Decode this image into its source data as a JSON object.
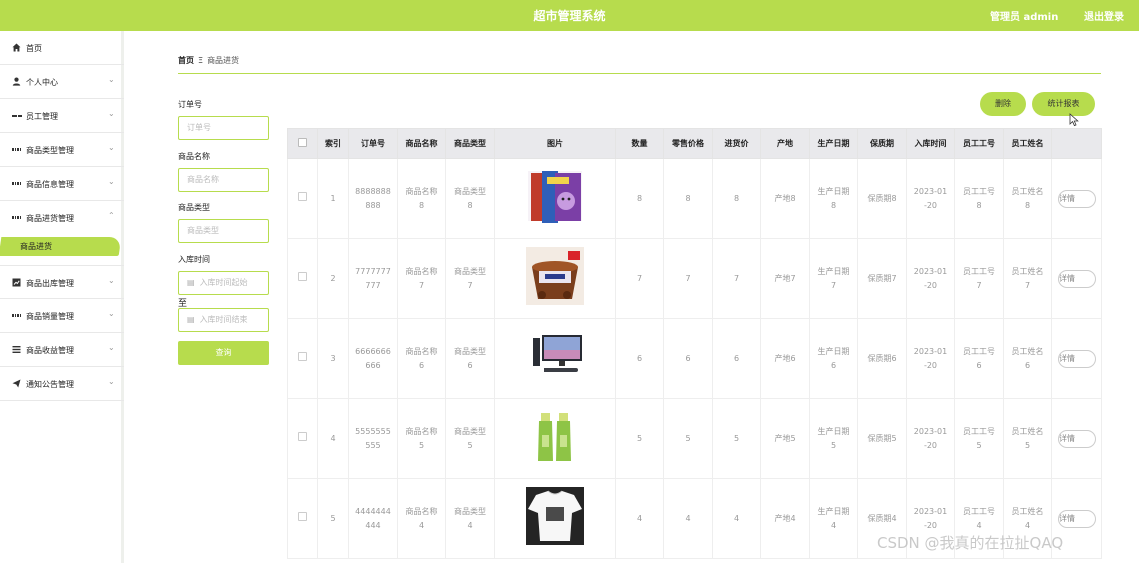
{
  "header": {
    "title": "超市管理系统",
    "user": "管理员 admin",
    "logout": "退出登录"
  },
  "sidebar": {
    "items": [
      {
        "label": "首页",
        "icon": "home-icon"
      },
      {
        "label": "个人中心",
        "icon": "user-icon"
      },
      {
        "label": "员工管理",
        "icon": "grid-icon"
      },
      {
        "label": "商品类型管理",
        "icon": "apps-icon"
      },
      {
        "label": "商品信息管理",
        "icon": "apps-icon"
      },
      {
        "label": "商品进货管理",
        "icon": "apps-icon"
      },
      {
        "label": "商品出库管理",
        "icon": "chart-icon"
      },
      {
        "label": "商品销量管理",
        "icon": "apps-icon"
      },
      {
        "label": "商品收益管理",
        "icon": "list-icon"
      },
      {
        "label": "通知公告管理",
        "icon": "send-icon"
      }
    ],
    "sub_item": "商品进货"
  },
  "breadcrumb": {
    "home": "首页",
    "sep": "Ξ",
    "current": "商品进货"
  },
  "filters": {
    "order_label": "订单号",
    "order_placeholder": "订单号",
    "name_label": "商品名称",
    "name_placeholder": "商品名称",
    "type_label": "商品类型",
    "type_placeholder": "商品类型",
    "time_label": "入库时间",
    "time_start_placeholder": "入库时间起始",
    "to_label": "至",
    "time_end_placeholder": "入库时间结束",
    "search": "查询"
  },
  "actions": {
    "delete": "删除",
    "stats": "统计报表"
  },
  "table": {
    "columns": [
      "索引",
      "订单号",
      "商品名称",
      "商品类型",
      "图片",
      "数量",
      "零售价格",
      "进货价",
      "产地",
      "生产日期",
      "保质期",
      "入库时间",
      "员工工号",
      "员工姓名"
    ],
    "detail_label": "详情",
    "rows": [
      {
        "index": "1",
        "order": [
          "8888888",
          "888"
        ],
        "name": [
          "商品名称",
          "8"
        ],
        "type": [
          "商品类型",
          "8"
        ],
        "qty": "8",
        "retail": "8",
        "cost": "8",
        "origin": "产地8",
        "prod": [
          "生产日期",
          "8"
        ],
        "shelf": "保质期8",
        "time": [
          "2023-01",
          "-20"
        ],
        "emp_no": [
          "员工工号",
          "8"
        ],
        "emp_name": [
          "员工姓名",
          "8"
        ]
      },
      {
        "index": "2",
        "order": [
          "7777777",
          "777"
        ],
        "name": [
          "商品名称",
          "7"
        ],
        "type": [
          "商品类型",
          "7"
        ],
        "qty": "7",
        "retail": "7",
        "cost": "7",
        "origin": "产地7",
        "prod": [
          "生产日期",
          "7"
        ],
        "shelf": "保质期7",
        "time": [
          "2023-01",
          "-20"
        ],
        "emp_no": [
          "员工工号",
          "7"
        ],
        "emp_name": [
          "员工姓名",
          "7"
        ]
      },
      {
        "index": "3",
        "order": [
          "6666666",
          "666"
        ],
        "name": [
          "商品名称",
          "6"
        ],
        "type": [
          "商品类型",
          "6"
        ],
        "qty": "6",
        "retail": "6",
        "cost": "6",
        "origin": "产地6",
        "prod": [
          "生产日期",
          "6"
        ],
        "shelf": "保质期6",
        "time": [
          "2023-01",
          "-20"
        ],
        "emp_no": [
          "员工工号",
          "6"
        ],
        "emp_name": [
          "员工姓名",
          "6"
        ]
      },
      {
        "index": "4",
        "order": [
          "5555555",
          "555"
        ],
        "name": [
          "商品名称",
          "5"
        ],
        "type": [
          "商品类型",
          "5"
        ],
        "qty": "5",
        "retail": "5",
        "cost": "5",
        "origin": "产地5",
        "prod": [
          "生产日期",
          "5"
        ],
        "shelf": "保质期5",
        "time": [
          "2023-01",
          "-20"
        ],
        "emp_no": [
          "员工工号",
          "5"
        ],
        "emp_name": [
          "员工姓名",
          "5"
        ]
      },
      {
        "index": "5",
        "order": [
          "4444444",
          "444"
        ],
        "name": [
          "商品名称",
          "4"
        ],
        "type": [
          "商品类型",
          "4"
        ],
        "qty": "4",
        "retail": "4",
        "cost": "4",
        "origin": "产地4",
        "prod": [
          "生产日期",
          "4"
        ],
        "shelf": "保质期4",
        "time": [
          "2023-01",
          "-20"
        ],
        "emp_no": [
          "员工工号",
          "4"
        ],
        "emp_name": [
          "员工姓名",
          "4"
        ]
      }
    ]
  },
  "watermark": "CSDN @我真的在拉扯QAQ",
  "colors": {
    "accent": "#b7dc4d",
    "header_bg": "#e9e9ec"
  }
}
